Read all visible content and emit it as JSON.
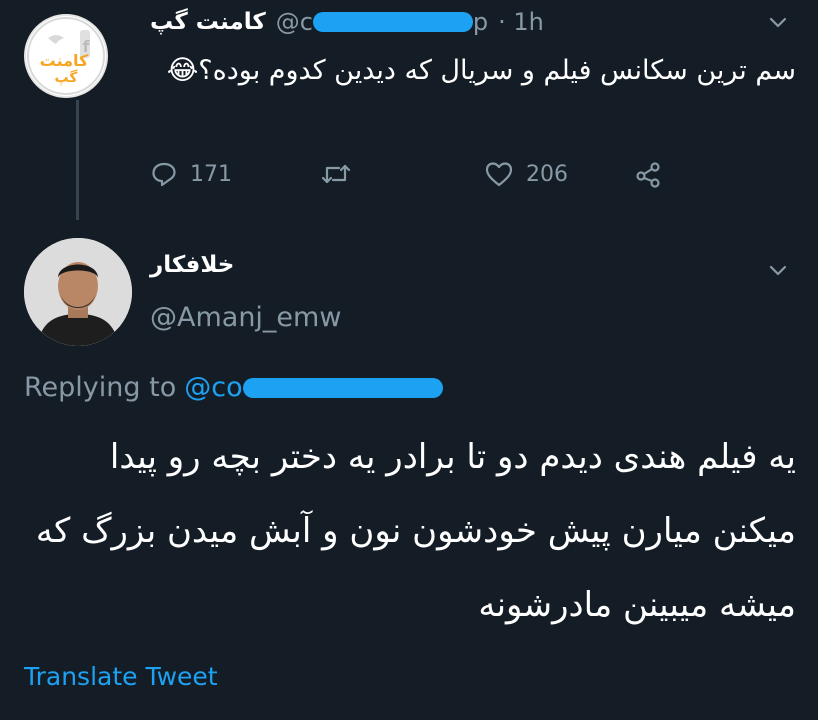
{
  "tweet1": {
    "display_name": "کامنت گپ",
    "handle_prefix": "@c",
    "handle_suffix": "p",
    "time": "· 1h",
    "text": "سم ترین سکانس فیلم و سریال که دیدین کدوم بوده؟😂",
    "reply_count": "171",
    "like_count": "206",
    "avatar_logo_text": "کامنت گپ"
  },
  "tweet2": {
    "display_name": "خلافکار",
    "handle": "@Amanj_emw",
    "replying_label": "Replying to",
    "replying_prefix": "@co",
    "text": "یه فیلم هندی دیدم دو تا برادر یه دختر بچه رو پیدا میکنن میارن پیش خودشون نون و آبش میدن بزرگ که میشه میبینن مادرشونه",
    "translate_label": "Translate Tweet"
  },
  "colors": {
    "background": "#141d26",
    "secondary_text": "#8899a6",
    "link": "#1da1f2",
    "thread_line": "#38444d"
  }
}
